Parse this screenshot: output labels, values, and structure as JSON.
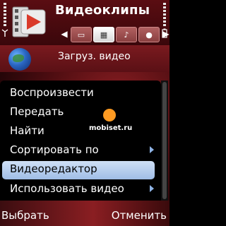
{
  "header": {
    "title": "Видеоклипы",
    "tabs": [
      {
        "icon": "presentation-icon",
        "active": false
      },
      {
        "icon": "film-icon",
        "active": true
      },
      {
        "icon": "music-note-icon",
        "active": false
      },
      {
        "icon": "microphone-icon",
        "active": false
      }
    ]
  },
  "item": {
    "label": "Загруз. видео",
    "icon": "globe-icon"
  },
  "menu": {
    "items": [
      {
        "label": "Воспроизвести",
        "submenu": false,
        "selected": false
      },
      {
        "label": "Передать",
        "submenu": false,
        "selected": false
      },
      {
        "label": "Найти",
        "submenu": false,
        "selected": false
      },
      {
        "label": "Сортировать по",
        "submenu": true,
        "selected": false
      },
      {
        "label": "Видеоредактор",
        "submenu": false,
        "selected": true
      },
      {
        "label": "Использовать видео",
        "submenu": true,
        "selected": false
      }
    ]
  },
  "watermark": {
    "text": "mobiset.ru"
  },
  "softkeys": {
    "left": "Выбрать",
    "right": "Отменить"
  },
  "colors": {
    "accent_selection": "#9fbde6",
    "background_theme": "#8a1e22",
    "menu_background": "#000000"
  }
}
